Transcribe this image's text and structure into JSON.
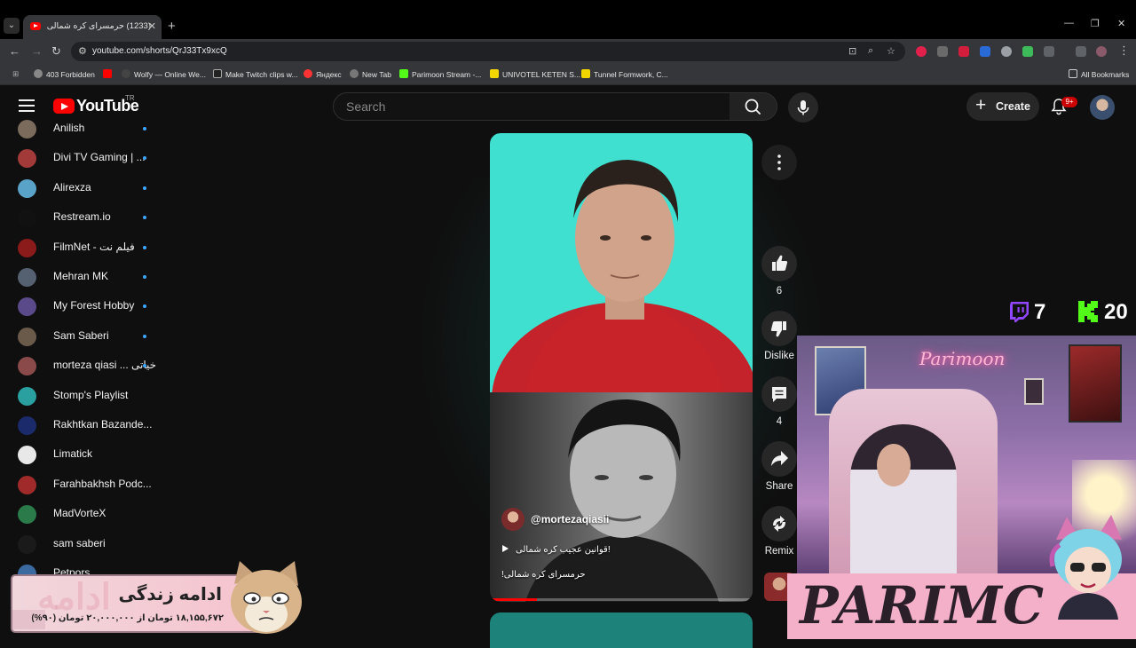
{
  "browser": {
    "tab_title": "(1233) حرمسرای کره شمالی!",
    "url": "youtube.com/shorts/QrJ33Tx9xcQ",
    "bookmarks": [
      {
        "label": "403 Forbidden",
        "color": "#888888"
      },
      {
        "label": "",
        "color": "#ff0000"
      },
      {
        "label": "Wolfy — Online We...",
        "color": "#444444"
      },
      {
        "label": "Make Twitch clips w...",
        "color": "#222222"
      },
      {
        "label": "Яндекс",
        "color": "#ff3333"
      },
      {
        "label": "New Tab",
        "color": "#777777"
      },
      {
        "label": "Parimoon Stream -...",
        "color": "#53fc18"
      },
      {
        "label": "UNIVOTEL KETEN S...",
        "color": "#f2d600"
      },
      {
        "label": "Tunnel Formwork, C...",
        "color": "#f2d600"
      }
    ],
    "all_bookmarks": "All Bookmarks"
  },
  "masthead": {
    "logo_text": "YouTube",
    "region": "TR",
    "search_placeholder": "Search",
    "create_label": "Create",
    "notification_count": "9+"
  },
  "sidebar": {
    "subscriptions": [
      {
        "name": "Anilish",
        "color": "#7a6b5c"
      },
      {
        "name": "Divi TV Gaming | ...",
        "color": "#a33a3a"
      },
      {
        "name": "Alirexza",
        "color": "#5aa3c8"
      },
      {
        "name": "Restream.io",
        "color": "#111111"
      },
      {
        "name": "FilmNet - فیلم نت",
        "color": "#8b1a1a"
      },
      {
        "name": "Mehran MK",
        "color": "#556070"
      },
      {
        "name": "My Forest Hobby",
        "color": "#5b4a8a"
      },
      {
        "name": "Sam Saberi",
        "color": "#6a5a4a"
      },
      {
        "name": "morteza qiasi ... خیاتی",
        "color": "#8a4a4a"
      },
      {
        "name": "Stomp's Playlist",
        "color": "#2aa0a0"
      },
      {
        "name": "Rakhtkan Bazande...",
        "color": "#1a2a6a"
      },
      {
        "name": "Limatick",
        "color": "#e8e8e8"
      },
      {
        "name": "Farahbakhsh Podc...",
        "color": "#a02a2a"
      },
      {
        "name": "MadVorteX",
        "color": "#2a7a4a"
      },
      {
        "name": "sam saberi",
        "color": "#1a1a1a"
      },
      {
        "name": "Petpors",
        "color": "#3a6aa0"
      }
    ]
  },
  "short": {
    "channel_handle": "@mortezaqiasii",
    "audio_title": "قوانین عجیب کره شمالی!",
    "description": "حرمسرای کره شمالی!",
    "progress": 0.18,
    "like_count": "6",
    "dislike_label": "Dislike",
    "comment_count": "4",
    "share_label": "Share",
    "remix_label": "Remix"
  },
  "stream_overlay": {
    "twitch_count": "7",
    "kick_count": "20",
    "webcam_sign": "Parimoon",
    "brand_text": "PARIMC",
    "donation_title": "ادامه زندگی",
    "donation_sub": "۱۸,۱۵۵,۶۷۲ تومان از ۲۰,۰۰۰,۰۰۰ تومان (۹۰%)",
    "donation_faint": "ادامه",
    "colors": {
      "twitch": "#9146ff",
      "kick": "#53fc18"
    }
  }
}
